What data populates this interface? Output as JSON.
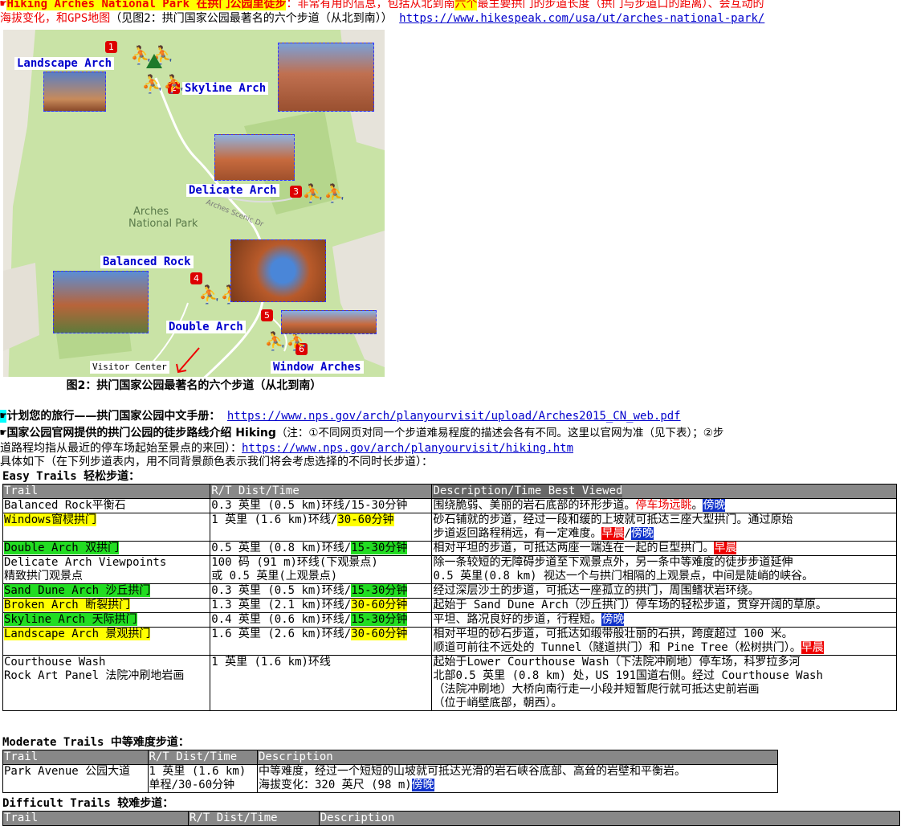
{
  "intro": {
    "hand": "☛",
    "title": "Hiking Arches National Park 在拱门公园里徒步",
    "text1": "：非常有用的信息，包括从北到南",
    "six": "六个",
    "text2": "最主要拱门的步道长度（拱门与步道口的距离）、会互动的",
    "line2": "海拔变化，和GPS地图",
    "line2b": "（见图2：拱门国家公园最著名的六个步道（从北到南））",
    "link": "https://www.hikespeak.com/usa/ut/arches-national-park/"
  },
  "map": {
    "labels": {
      "landscape": "Landscape Arch",
      "skyline": "Skyline Arch",
      "delicate": "Delicate Arch",
      "balanced": "Balanced Rock",
      "double": "Double Arch",
      "windows": "Window Arches",
      "visitor": "Visitor Center",
      "park1": "Arches",
      "park2": "National Park",
      "road": "Arches Scenic Dr"
    },
    "nums": [
      "1",
      "2",
      "3",
      "4",
      "5",
      "6"
    ],
    "caption": "图2：拱门国家公园最著名的六个步道（从北到南）"
  },
  "plan": {
    "hand": "☛",
    "label": "计划您的旅行——拱门国家公园中文手册：",
    "link": "https://www.nps.gov/arch/planyourvisit/upload/Arches2015_CN_web.pdf"
  },
  "official": {
    "hand": "☛",
    "label": "国家公园官网提供的拱门公园的徒步路线介绍 Hiking",
    "note": "（注：①不同网页对同一个步道难易程度的描述会各有不同。这里以官网为准（见下表）；②步",
    "line2": "道路程均指从最近的停车场起始至景点的来回）：",
    "link": "https://www.nps.gov/arch/planyourvisit/hiking.htm",
    "line3": "具体如下（在下列步道表内，用不同背景颜色表示我们将会考虑选择的不同时长步道）："
  },
  "easy": {
    "title": "Easy Trails 轻松步道：",
    "headers": [
      "Trail",
      "R/T Dist/Time",
      "Description/Time Best Viewed"
    ],
    "rows": [
      {
        "trail": "Balanced Rock平衡石",
        "dist": "0.3 英里 (0.5 km)环线/15-30分钟",
        "desc": "围绕脆弱、美丽的岩石底部的环形步道。",
        "descRed": "停车场远眺",
        "descEnd": "。",
        "tag1": "傍晚"
      },
      {
        "trail": "Windows窗棂拱门",
        "dist": "1 英里 (1.6 km)环线/",
        "distHl": "30-60分钟",
        "desc": "砂石铺就的步道，经过一段和缓的上坡就可抵达三座大型拱门。通过原始",
        "desc2": "步道返回路程稍远，有一定难度。",
        "tag1": "早晨",
        "tag2": "傍晚"
      },
      {
        "trail": "Double Arch 双拱门",
        "dist": "0.5 英里 (0.8 km)环线/",
        "distHl": "15-30分钟",
        "desc": "相对平坦的步道，可抵达两座一端连在一起的巨型拱门。",
        "tag1": "早晨"
      },
      {
        "trail": "Delicate Arch Viewpoints",
        "trail2": "精致拱门观景点",
        "dist": "100 码 (91 m)环线(下观景点)",
        "dist2": "或 0.5 英里(上观景点)",
        "desc": "除一条较短的无障碍步道至下观景点外，另一条中等难度的徒步步道延伸",
        "desc2": "0.5 英里(0.8 km) 视达一个与拱门相隔的上观景点，中间是陡峭的峡谷。"
      },
      {
        "trail": "Sand Dune Arch 沙丘拱门",
        "dist": "0.3 英里 (0.5 km)环线/",
        "distHl": "15-30分钟",
        "desc": "经过深层沙土的步道，可抵达一座孤立的拱门，周围鳍状岩环绕。"
      },
      {
        "trail": "Broken Arch 断裂拱门",
        "dist": "1.3 英里 (2.1 km)环线/",
        "distHl": "30-60分钟",
        "desc": "起始于 Sand Dune Arch（沙丘拱门）停车场的轻松步道，贯穿开阔的草原。"
      },
      {
        "trail": "Skyline Arch 天际拱门",
        "dist": "0.4 英里 (0.6 km)环线/",
        "distHl": "15-30分钟",
        "desc": "平坦、路况良好的步道，行程短。",
        "tag1": "傍晚"
      },
      {
        "trail": "Landscape Arch 景观拱门",
        "dist": "1.6 英里 (2.6 km)环线/",
        "distHl": "30-60分钟",
        "desc": "相对平坦的砂石步道，可抵达如缎带般壮丽的石拱，跨度超过 100 米。",
        "desc2": "顺道可前往不远处的 Tunnel（隧道拱门）和 Pine Tree（松树拱门）。",
        "tag1": "早晨"
      },
      {
        "trail": "Courthouse Wash",
        "trail2": "Rock Art Panel 法院冲刷地岩画",
        "dist": "1 英里 (1.6 km)环线",
        "desc": "起始于Lower Courthouse Wash（下法院冲刷地）停车场，科罗拉多河",
        "desc2": "北部0.5 英里 (0.8 km) 处，US 191国道右侧。经过 Courthouse Wash",
        "desc3": "（法院冲刷地）大桥向南行走一小段并短暂爬行就可抵达史前岩画",
        "desc4": "（位于峭壁底部，朝西）。"
      }
    ]
  },
  "moderate": {
    "title": "Moderate Trails 中等难度步道：",
    "headers": [
      "Trail",
      "R/T Dist/Time",
      "Description"
    ],
    "rows": [
      {
        "trail": "Park Avenue 公园大道",
        "dist": "1 英里 (1.6 km)",
        "dist2": "单程/30-60分钟",
        "desc": "中等难度，经过一个短短的山坡就可抵达光滑的岩石峡谷底部、高耸的岩壁和平衡岩。",
        "desc2": "海拔变化：320 英尺 (98 m)",
        "tag1": "傍晚"
      }
    ]
  },
  "difficult": {
    "title": "Difficult Trails 较难步道：",
    "headers": [
      "Trail",
      "R/T Dist/Time",
      "Description"
    ]
  }
}
